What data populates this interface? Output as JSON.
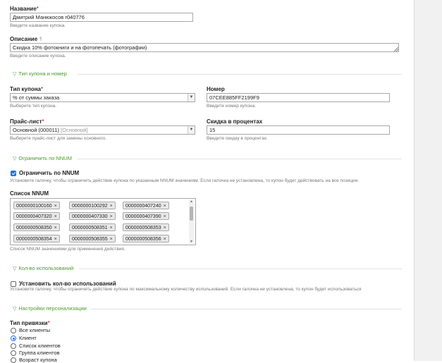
{
  "name": {
    "label": "Название",
    "required_mark": "*",
    "value": "Дмитрий Манюкосов r040776",
    "hint": "Введите название купона."
  },
  "description": {
    "label": "Описание",
    "value": "Скидка 10% фотокниги и на фотопечать (фотографии)",
    "hint": "Введите описание купона."
  },
  "section_type": {
    "title": "Тип купона и номер"
  },
  "coupon_type": {
    "label": "Тип купона",
    "required_mark": "*",
    "value": "% от суммы заказа",
    "hint": "Выберите тип купона."
  },
  "number": {
    "label": "Номер",
    "value": "07CEE885FF2199F9",
    "hint": "Введите номер купона."
  },
  "price_list": {
    "label": "Прайс-лист",
    "required_mark": "*",
    "value": "Основной (000011)",
    "value_muted": "[Основной]",
    "hint": "Выберите прайс-лист для замены основного."
  },
  "discount": {
    "label": "Скидка в процентах",
    "value": "15",
    "hint": "Введите скидку в процентах."
  },
  "section_nnum": {
    "title": "Ограничить по NNUM"
  },
  "limit_nnum": {
    "label": "Ограничить по NNUM",
    "checked": true,
    "hint": "Установите галочку, чтобы ограничить действие купона по указанным NNUM значениям. Если галочка не установлена, то купон будет действовать на все позиции."
  },
  "nnum_list": {
    "label": "Список NNUM",
    "tags": [
      "0000000100160",
      "0000000100292",
      "0000000407240",
      "0000000407320",
      "0000000407330",
      "0000000407390",
      "0000000508350",
      "0000000508351",
      "0000000508353",
      "0000000508354",
      "0000000508355",
      "0000000508356"
    ],
    "remove_glyph": "×",
    "hint": "Список NNUM значениями для применения действия."
  },
  "section_usage": {
    "title": "Кол-во использований"
  },
  "usage_limit": {
    "label": "Установить кол-во использований",
    "checked": false,
    "hint": "Установите галочку, чтобы ограничить действие купона по максимальному количеству использований. Если галочка не установлена, то купон будет использоваться"
  },
  "section_personal": {
    "title": "Настройки персонализации"
  },
  "binding": {
    "label": "Тип привязки",
    "required_mark": "*",
    "options": [
      "Все клиенты",
      "Клиент",
      "Список клиентов",
      "Группа клиентов",
      "Возраст купона"
    ],
    "selected": "Клиент"
  },
  "icons": {
    "section_toggle": "triangle-down-icon",
    "select_arrow": "chevron-down-icon",
    "description_info": "text-format-icon"
  },
  "colors": {
    "section_title": "#4a9a2a",
    "required": "#cc0000",
    "checkbox_on": "#1a73e8"
  }
}
